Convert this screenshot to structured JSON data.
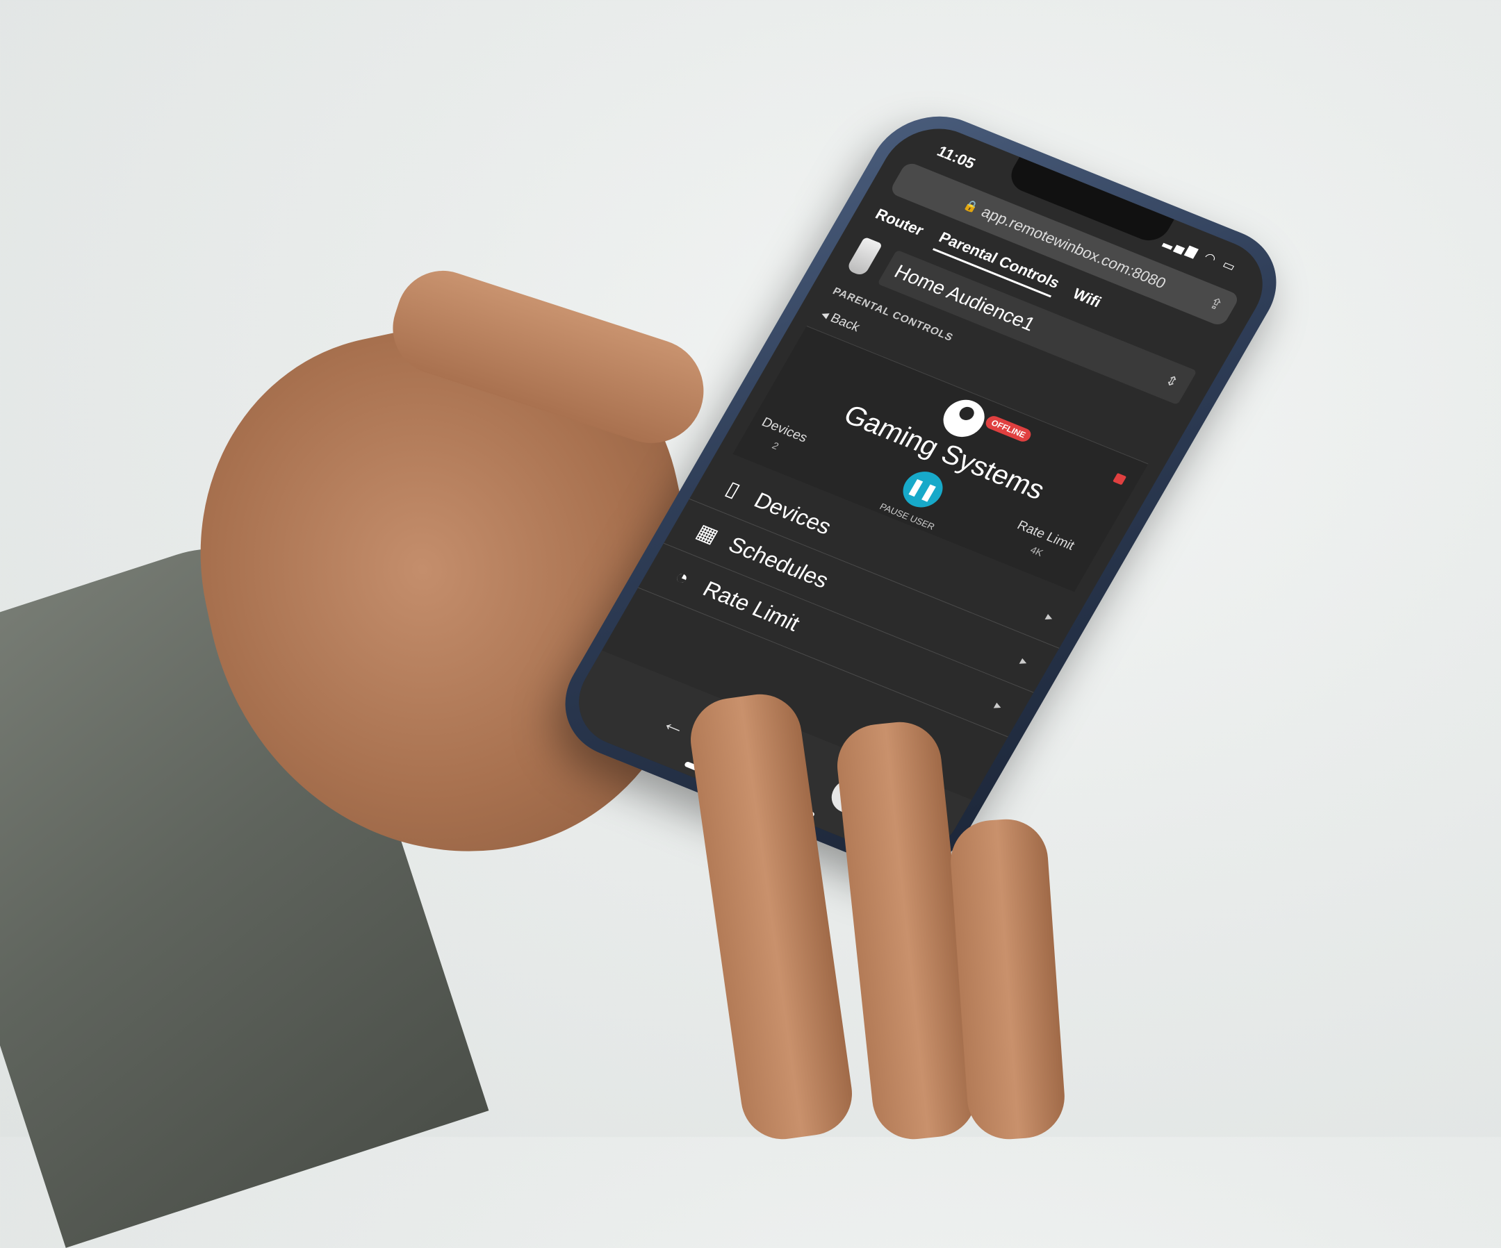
{
  "status": {
    "time": "11:05",
    "icons": "▂▄▆ ◠ ▭"
  },
  "browser": {
    "url": "app.remotewinbox.com:8080"
  },
  "tabs": [
    {
      "label": "Router"
    },
    {
      "label": "Parental Controls"
    },
    {
      "label": "Wifi"
    }
  ],
  "profile": {
    "selected": "Home Audience1"
  },
  "section": {
    "label": "PARENTAL CONTROLS"
  },
  "nav": {
    "back_label": "Back"
  },
  "user_card": {
    "name": "Gaming Systems",
    "status_badge": "OFFLINE",
    "devices_label": "Devices",
    "devices_count": "2",
    "pause_label": "PAUSE USER",
    "rate_label": "Rate Limit",
    "rate_value": "4K"
  },
  "menu": {
    "items": [
      {
        "label": "Devices",
        "icon": "tablet-icon"
      },
      {
        "label": "Schedules",
        "icon": "calendar-icon"
      },
      {
        "label": "Rate Limit",
        "icon": "gauge-icon"
      }
    ]
  },
  "colors": {
    "accent": "#17a9c9",
    "badge": "#e04040",
    "screen_bg": "#2b2b2b"
  }
}
